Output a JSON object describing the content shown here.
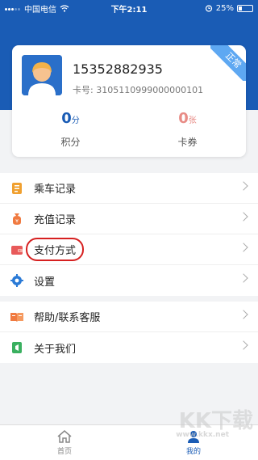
{
  "status_bar": {
    "carrier": "中国电信",
    "time": "下午2:11",
    "battery": "25%",
    "battery_level": 0.25
  },
  "account": {
    "phone": "15352882935",
    "card_number": "卡号: 3105110999000000101",
    "status_ribbon": "正常",
    "points_value": "0",
    "points_unit": "分",
    "points_label": "积分",
    "coupons_value": "0",
    "coupons_unit": "张",
    "coupons_label": "卡券"
  },
  "menu_group_1": [
    {
      "label": "乘车记录",
      "icon": "ride-record-icon",
      "color": "#f0a030"
    },
    {
      "label": "充值记录",
      "icon": "recharge-bag-icon",
      "color": "#f07a40"
    },
    {
      "label": "支付方式",
      "icon": "wallet-icon",
      "color": "#e85a5a",
      "highlighted": true
    },
    {
      "label": "设置",
      "icon": "gear-icon",
      "color": "#2a7ad6"
    }
  ],
  "menu_group_2": [
    {
      "label": "帮助/联系客服",
      "icon": "help-book-icon",
      "color": "#f07a40"
    },
    {
      "label": "关于我们",
      "icon": "about-icon",
      "color": "#3ab060"
    }
  ],
  "tabbar": {
    "home_label": "首页",
    "mine_label": "我的"
  },
  "watermark": {
    "main": "KK下载",
    "sub": "www.kkx.net"
  },
  "colors": {
    "header": "#1a5cb5",
    "highlight_circle": "#d62020"
  }
}
